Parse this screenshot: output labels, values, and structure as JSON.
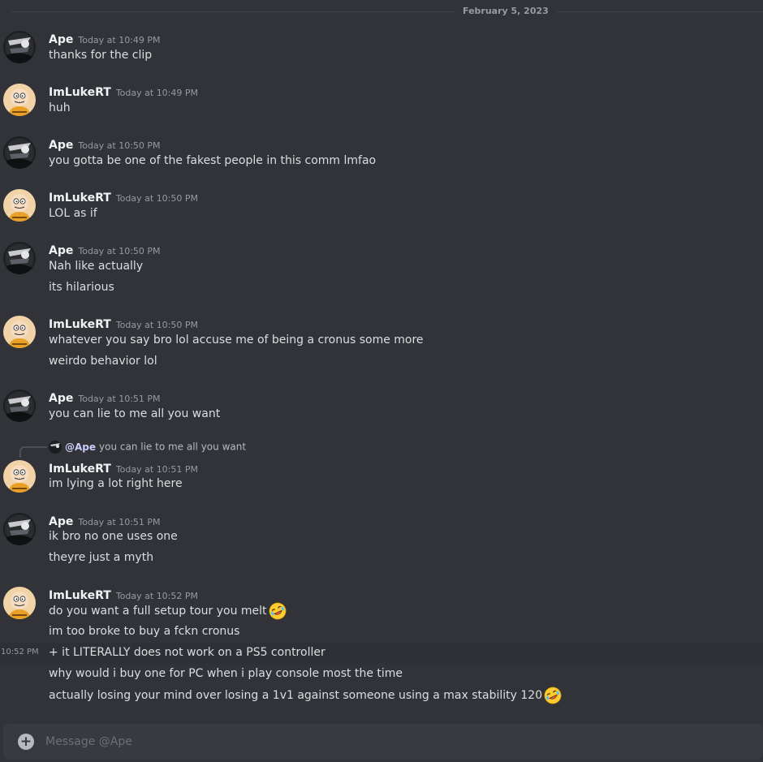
{
  "divider": {
    "date": "February 5, 2023"
  },
  "colors": {
    "background": "#313338",
    "username": "#f2f3f5",
    "timestamp": "#949ba4",
    "text": "#dbdee1",
    "mention": "#c9cdfb",
    "composer": "#383a40"
  },
  "messages": [
    {
      "author": "Ape",
      "timestamp": "Today at 10:49 PM",
      "lines": [
        "thanks for the clip"
      ]
    },
    {
      "author": "ImLukeRT",
      "timestamp": "Today at 10:49 PM",
      "lines": [
        "huh"
      ]
    },
    {
      "author": "Ape",
      "timestamp": "Today at 10:50 PM",
      "lines": [
        "you gotta be one of the fakest people in this comm lmfao"
      ]
    },
    {
      "author": "ImLukeRT",
      "timestamp": "Today at 10:50 PM",
      "lines": [
        "LOL as if"
      ]
    },
    {
      "author": "Ape",
      "timestamp": "Today at 10:50 PM",
      "lines": [
        "Nah like actually",
        "its hilarious"
      ]
    },
    {
      "author": "ImLukeRT",
      "timestamp": "Today at 10:50 PM",
      "lines": [
        "whatever you say bro lol accuse me of being a cronus some more",
        "weirdo behavior lol"
      ]
    },
    {
      "author": "Ape",
      "timestamp": "Today at 10:51 PM",
      "lines": [
        "you can lie to me all you want"
      ]
    },
    {
      "author": "ImLukeRT",
      "timestamp": "Today at 10:51 PM",
      "reply": {
        "mention": "@Ape",
        "text": "you can lie to me all you want"
      },
      "lines": [
        "im lying a lot right here"
      ]
    },
    {
      "author": "Ape",
      "timestamp": "Today at 10:51 PM",
      "lines": [
        "ik bro no one uses one",
        "theyre just a myth"
      ]
    },
    {
      "author": "ImLukeRT",
      "timestamp": "Today at 10:52 PM",
      "lines": [
        "do you want a full setup tour you melt",
        "im too broke to buy a fckn cronus",
        "+ it LITERALLY does not work on a PS5 controller",
        "why would i buy one for PC when i play console most the time",
        "actually losing your mind over losing a 1v1 against someone using a max stability 120"
      ],
      "emoji": "rolling-on-floor-laughing-emoji"
    }
  ],
  "hover_timestamp": "10:52 PM",
  "composer": {
    "placeholder": "Message @Ape",
    "icon": "plus-circle-icon"
  }
}
